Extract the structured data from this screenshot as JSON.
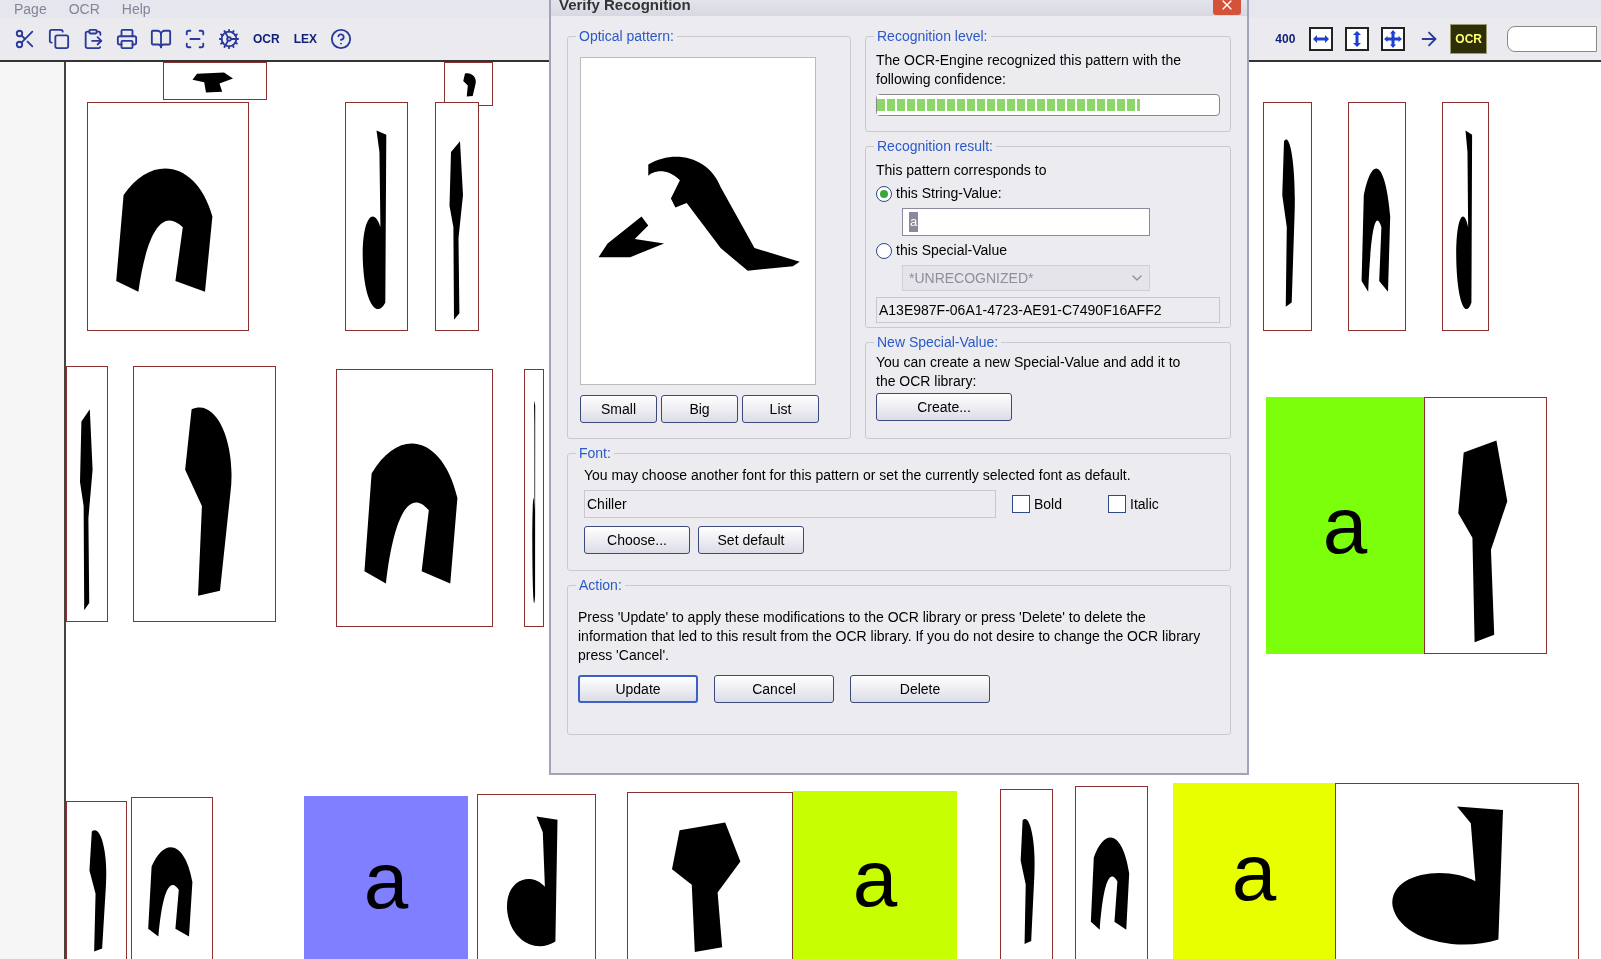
{
  "menu_bar": [
    {
      "label": "Page",
      "disabled": true
    },
    {
      "label": "OCR",
      "disabled": true
    },
    {
      "label": "Help",
      "disabled": true
    }
  ],
  "toolbar_left": [
    {
      "kind": "cut"
    },
    {
      "kind": "copy"
    },
    {
      "kind": "paste"
    },
    {
      "kind": "print"
    },
    {
      "kind": "book"
    },
    {
      "kind": "scanner"
    },
    {
      "kind": "gears"
    },
    {
      "kind": "text",
      "label": "OCR"
    },
    {
      "kind": "text",
      "label": "LEX"
    },
    {
      "kind": "help"
    }
  ],
  "toolbar_right": [
    {
      "kind": "text",
      "label": "400",
      "pressed": false
    },
    {
      "kind": "fit-width",
      "pressed": false
    },
    {
      "kind": "fit-height",
      "pressed": false
    },
    {
      "kind": "fit-page",
      "pressed": false
    },
    {
      "kind": "arrow",
      "pressed": false
    },
    {
      "kind": "text",
      "label": "OCR",
      "pressed": true
    }
  ],
  "canvas": {
    "recognized": [
      {
        "text": "a",
        "color": "#7cff0a"
      },
      {
        "text": "a",
        "color": "#7f7fff"
      },
      {
        "text": "a",
        "color": "#c8ff00"
      },
      {
        "text": "a",
        "color": "#e8ff00"
      }
    ]
  },
  "dialog": {
    "title": "Verify Recognition",
    "optical_pattern": {
      "legend": "Optical pattern:",
      "buttons": [
        "Small",
        "Big",
        "List"
      ]
    },
    "recognition_level": {
      "legend": "Recognition level:",
      "text": "The OCR-Engine recognized this pattern with the following confidence:",
      "level": 0.77
    },
    "recognition_result": {
      "legend": "Recognition result:",
      "text": "This pattern corresponds to",
      "options": [
        {
          "label": "this String-Value:",
          "selected": true
        },
        {
          "label": "this Special-Value",
          "selected": false
        }
      ],
      "string_value": "a",
      "special_value": {
        "value": "*UNRECOGNIZED*",
        "disabled": true
      },
      "guid": "A13E987F-06A1-4723-AE91-C7490F16AFF2"
    },
    "new_special_value": {
      "legend": "New Special-Value:",
      "text": "You can create a new Special-Value and add it to the OCR library:",
      "button": "Create..."
    },
    "font": {
      "legend": "Font:",
      "text": "You may choose another font for this pattern or set the currently selected font as default.",
      "value": "Chiller",
      "checkboxes": [
        {
          "label": "Bold",
          "checked": false
        },
        {
          "label": "Italic",
          "checked": false
        }
      ],
      "buttons": [
        "Choose...",
        "Set default"
      ]
    },
    "action": {
      "legend": "Action:",
      "text": "Press 'Update' to apply these modifications to the OCR library or press 'Delete' to delete the information that led to this result from the OCR library. If you do not desire to change the OCR library press 'Cancel'.",
      "buttons": [
        {
          "label": "Update",
          "default": true
        },
        {
          "label": "Cancel",
          "default": false
        },
        {
          "label": "Delete",
          "default": false
        }
      ]
    }
  }
}
